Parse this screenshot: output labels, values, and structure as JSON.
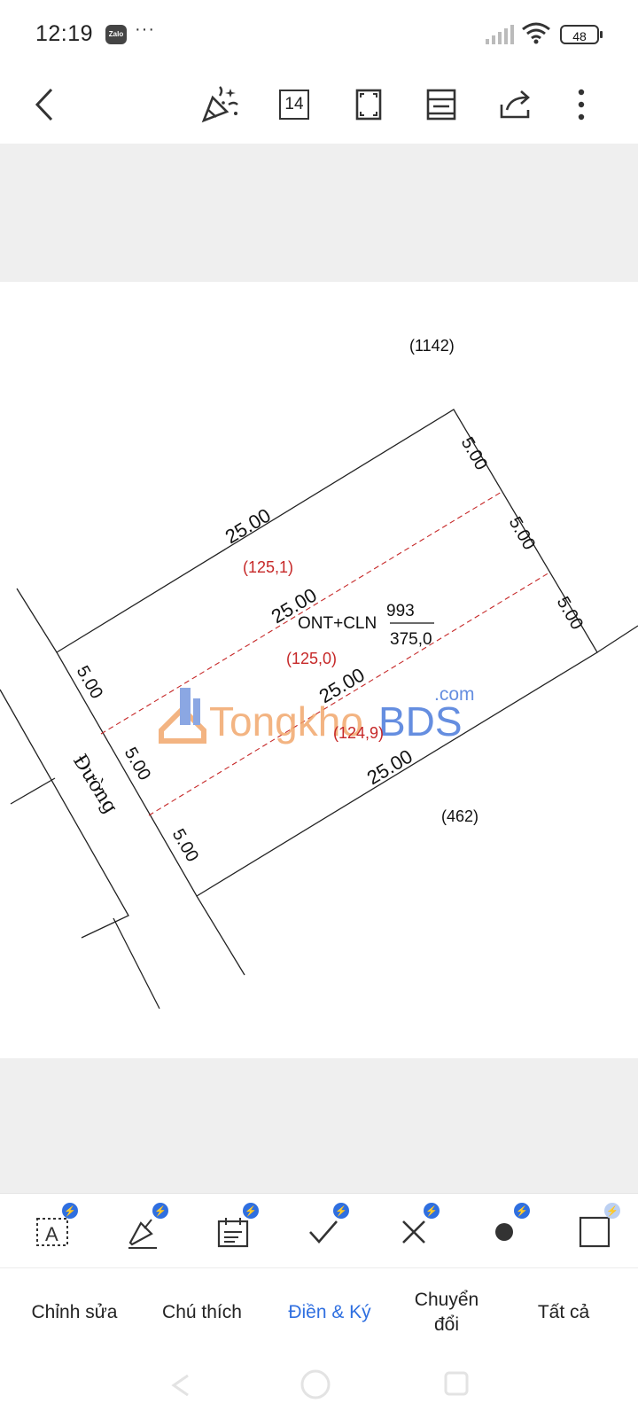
{
  "status": {
    "time": "12:19",
    "app_badge": "Zalo",
    "more": "···",
    "battery": "48"
  },
  "toolbar": {
    "page_number": "14"
  },
  "drawing": {
    "parcel_above": "(1142)",
    "parcel_below": "(462)",
    "road_label": "Đường",
    "land_use": "ONT+CLN",
    "parcel_number": "993",
    "area": "375,0",
    "top_edge": "25.00",
    "mid_edge_1": "25.00",
    "mid_edge_2": "25.00",
    "bottom_edge": "25.00",
    "right_side_1": "5.00",
    "right_side_2": "5.00",
    "right_side_3": "5.00",
    "left_side_1": "5.00",
    "left_side_2": "5.00",
    "left_side_3": "5.00",
    "strip_area_1": "(125,1)",
    "strip_area_2": "(125,0)",
    "strip_area_3": "(124,9)",
    "accent_red": "#c62828"
  },
  "watermark": {
    "part1": "Tongkho",
    "part2": "BDS",
    "suffix": ".com"
  },
  "tools": [
    "text-box-icon",
    "pen-icon",
    "date-icon",
    "check-icon",
    "cross-icon",
    "dot-icon",
    "rectangle-icon"
  ],
  "tabs": {
    "edit": "Chỉnh sửa",
    "annotate": "Chú thích",
    "fill_sign": "Điền & Ký",
    "convert": "Chuyển đổi",
    "all": "Tất cả"
  },
  "colors": {
    "accent": "#2f6fe0",
    "watermark_orange": "#f0a060",
    "watermark_blue": "#3b6fd8"
  }
}
